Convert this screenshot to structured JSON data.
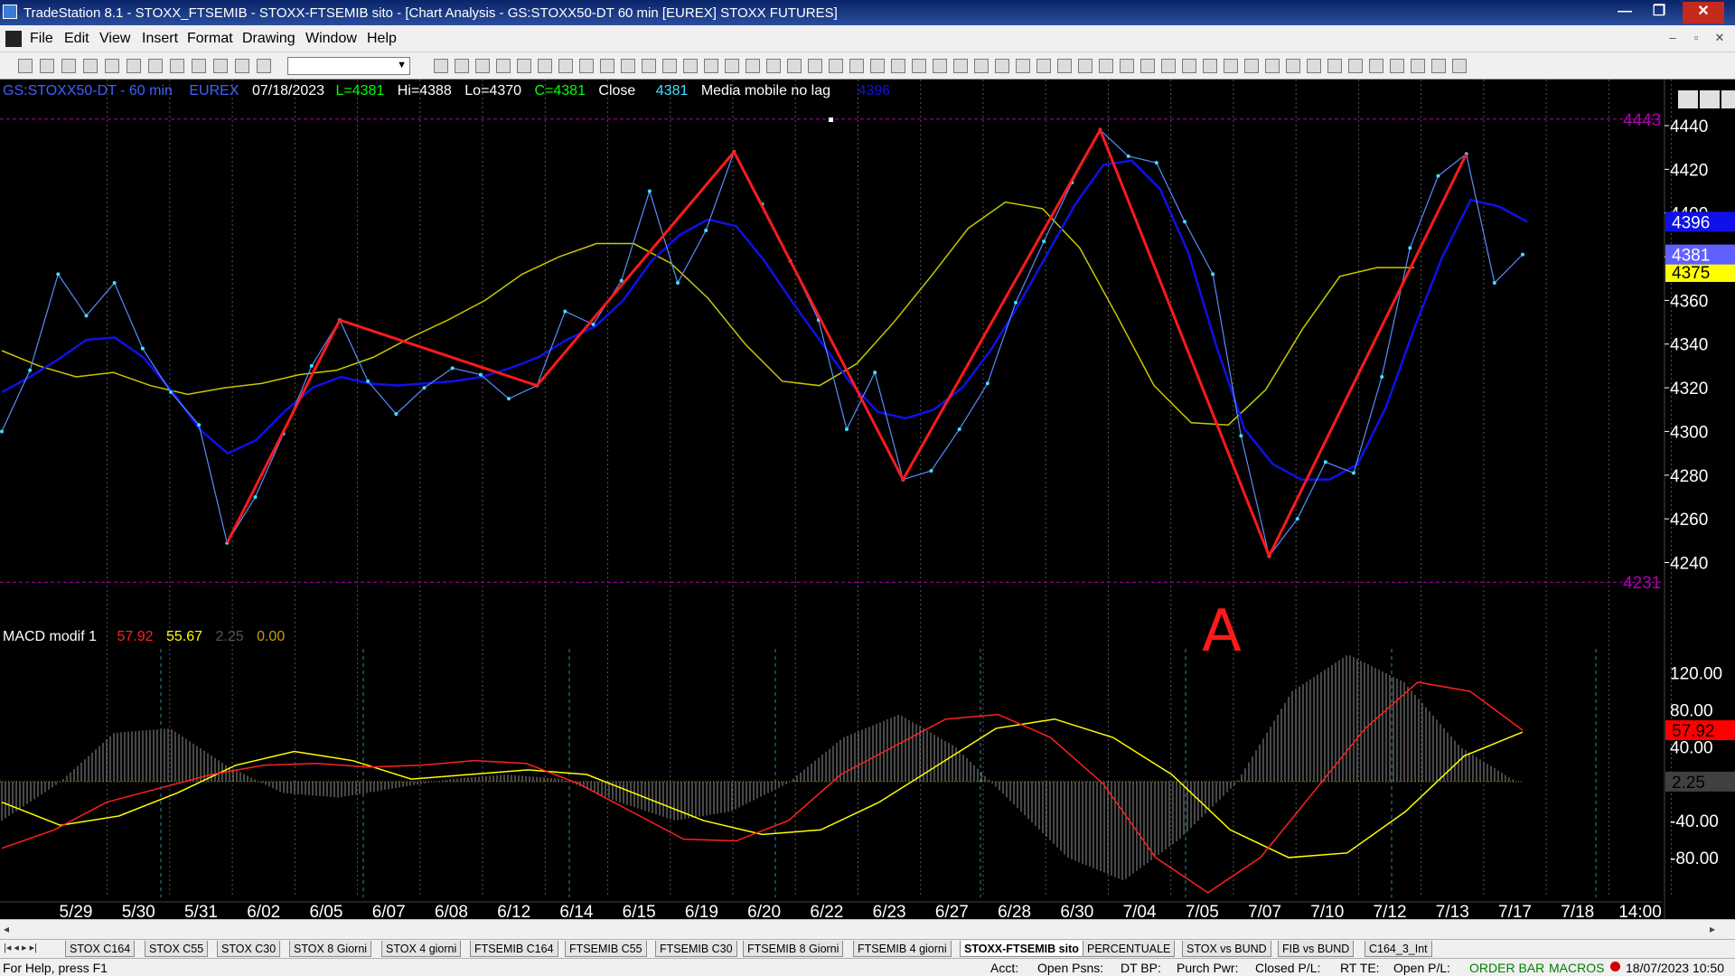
{
  "window": {
    "title": "TradeStation 8.1 - STOXX_FTSEMIB - STOXX-FTSEMIB sito - [Chart Analysis - GS:STOXX50-DT  60 min  [EUREX] STOXX FUTURES]",
    "minimize": "—",
    "restore": "❐",
    "close": "✕"
  },
  "menu": {
    "items": [
      "File",
      "Edit",
      "View",
      "Insert",
      "Format",
      "Drawing",
      "Window",
      "Help"
    ],
    "mdi_minimize": "–",
    "mdi_restore": "▫",
    "mdi_close": "✕"
  },
  "toolbar": {
    "combo_value": ""
  },
  "chart": {
    "symbol": "GS:STOXX50-DT - 60 min",
    "exchange": "EUREX",
    "date": "07/18/2023",
    "last": "L=4381",
    "high": "Hi=4388",
    "low": "Lo=4370",
    "close": "C=4381",
    "close_label": "Close",
    "close_value": "4381",
    "indicator_name": "Media mobile no lag",
    "indicator_value": "4396",
    "level_high": "4443",
    "level_low": "4231",
    "price_badges": {
      "blue": "4396",
      "last": "4381",
      "yellow": "4375"
    },
    "annotation": "A",
    "colors": {
      "background": "#000000",
      "price": "#5a8cff",
      "price_points": "#40e0ff",
      "ma_blue": "#1010e8",
      "ma_yellow": "#c8c800",
      "trend": "#ff1a1a",
      "level": "#b000b0",
      "macd_red": "#ff2020",
      "macd_yellow": "#ffff00",
      "histogram": "#909090"
    }
  },
  "macd": {
    "name": "MACD modif 1",
    "macd": "57.92",
    "signal": "55.67",
    "diff": "2.25",
    "zero": "0.00",
    "badges": {
      "red": "57.92",
      "gray": "2.25"
    }
  },
  "chart_data": [
    {
      "type": "line",
      "title": "GS:STOXX50-DT - 60 min",
      "xlabel": "",
      "ylabel": "",
      "x_ticks": [
        "5/29",
        "5/30",
        "5/31",
        "6/02",
        "6/05",
        "6/07",
        "6/08",
        "6/12",
        "6/14",
        "6/15",
        "6/19",
        "6/20",
        "6/22",
        "6/23",
        "6/27",
        "6/28",
        "6/30",
        "7/04",
        "7/05",
        "7/07",
        "7/10",
        "7/12",
        "7/13",
        "7/17",
        "7/18",
        "14:00"
      ],
      "y_ticks": [
        4240,
        4260,
        4280,
        4300,
        4320,
        4340,
        4360,
        4380,
        4400,
        4420,
        4440
      ],
      "ylim": [
        4222,
        4452
      ],
      "reference_lines": [
        4443,
        4231
      ],
      "series": [
        {
          "name": "Close",
          "values": [
            4300,
            4328,
            4372,
            4353,
            4368,
            4338,
            4318,
            4303,
            4249,
            4270,
            4299,
            4330,
            4351,
            4323,
            4308,
            4320,
            4329,
            4326,
            4315,
            4321,
            4355,
            4349,
            4369,
            4410,
            4368,
            4392,
            4428,
            4404,
            4378,
            4351,
            4301,
            4327,
            4278,
            4282,
            4301,
            4322,
            4359,
            4387,
            4414,
            4438,
            4426,
            4423,
            4396,
            4372,
            4298,
            4243,
            4260,
            4286,
            4281,
            4325,
            4384,
            4417,
            4427,
            4368,
            4381
          ]
        },
        {
          "name": "Media mobile no lag",
          "values": [
            4318,
            4325,
            4333,
            4342,
            4343,
            4334,
            4319,
            4301,
            4290,
            4296,
            4309,
            4320,
            4325,
            4322,
            4321,
            4322,
            4323,
            4325,
            4329,
            4334,
            4342,
            4348,
            4360,
            4378,
            4390,
            4397,
            4394,
            4378,
            4359,
            4341,
            4323,
            4309,
            4306,
            4310,
            4320,
            4337,
            4358,
            4381,
            4404,
            4422,
            4424,
            4411,
            4382,
            4339,
            4301,
            4285,
            4278,
            4278,
            4285,
            4311,
            4347,
            4380,
            4406,
            4403,
            4396
          ]
        },
        {
          "name": "",
          "values": [
            4337,
            4330,
            4325,
            4327,
            4321,
            4317,
            4320,
            4322,
            4326,
            4328,
            4334,
            4343,
            4351,
            4360,
            4372,
            4380,
            4386,
            4386,
            4377,
            4361,
            4340,
            4323,
            4321,
            4331,
            4350,
            4371,
            4393,
            4405,
            4402,
            4384,
            4353,
            4321,
            4304,
            4303,
            4319,
            4347,
            4371,
            4375,
            4375
          ]
        }
      ]
    },
    {
      "type": "line",
      "title": "MACD modif 1",
      "ylim": [
        -130,
        150
      ],
      "y_ticks": [
        -80,
        -40,
        40,
        80,
        120
      ],
      "series": [
        {
          "name": "MACD",
          "values": [
            -70,
            -50,
            -20,
            -5,
            10,
            20,
            22,
            18,
            20,
            25,
            22,
            0,
            -30,
            -60,
            -62,
            -40,
            10,
            40,
            70,
            75,
            50,
            0,
            -80,
            -118,
            -80,
            -10,
            60,
            110,
            100,
            58
          ]
        },
        {
          "name": "Signal",
          "values": [
            -20,
            -45,
            -35,
            -10,
            20,
            35,
            25,
            5,
            10,
            15,
            10,
            -15,
            -40,
            -55,
            -50,
            -20,
            20,
            60,
            70,
            50,
            10,
            -50,
            -80,
            -75,
            -30,
            30,
            56
          ]
        },
        {
          "name": "Histogram",
          "values": [
            -40,
            0,
            55,
            60,
            20,
            -10,
            -15,
            -5,
            5,
            10,
            5,
            -20,
            -40,
            -30,
            0,
            50,
            75,
            40,
            -20,
            -80,
            -105,
            -60,
            0,
            100,
            140,
            110,
            40,
            2
          ]
        }
      ]
    }
  ],
  "scrollbar": {
    "left": "◂",
    "right": "▸"
  },
  "tabs": {
    "nav": "|◂ ◂ ▸ ▸|",
    "items": [
      "STOX C164",
      "STOX C55",
      "STOX C30",
      "STOX 8 Giorni",
      "STOX 4 giorni",
      "FTSEMIB C164",
      "FTSEMIB C55",
      "FTSEMIB C30",
      "FTSEMIB 8 Giorni",
      "FTSEMIB 4 giorni",
      "STOXX-FTSEMIB sito",
      "PERCENTUALE",
      "STOX vs BUND",
      "FIB vs BUND",
      "C164_3_Int"
    ],
    "active": 10
  },
  "status": {
    "help": "For Help, press F1",
    "acct": "Acct:",
    "open_psns": "Open Psns:",
    "dt_bp": "DT BP:",
    "purch_pwr": "Purch Pwr:",
    "closed_pl": "Closed P/L:",
    "rt_te": "RT TE:",
    "open_pl": "Open P/L:",
    "order_bar": "ORDER BAR",
    "macros": "MACROS",
    "datetime": "18/07/2023 10:50"
  }
}
